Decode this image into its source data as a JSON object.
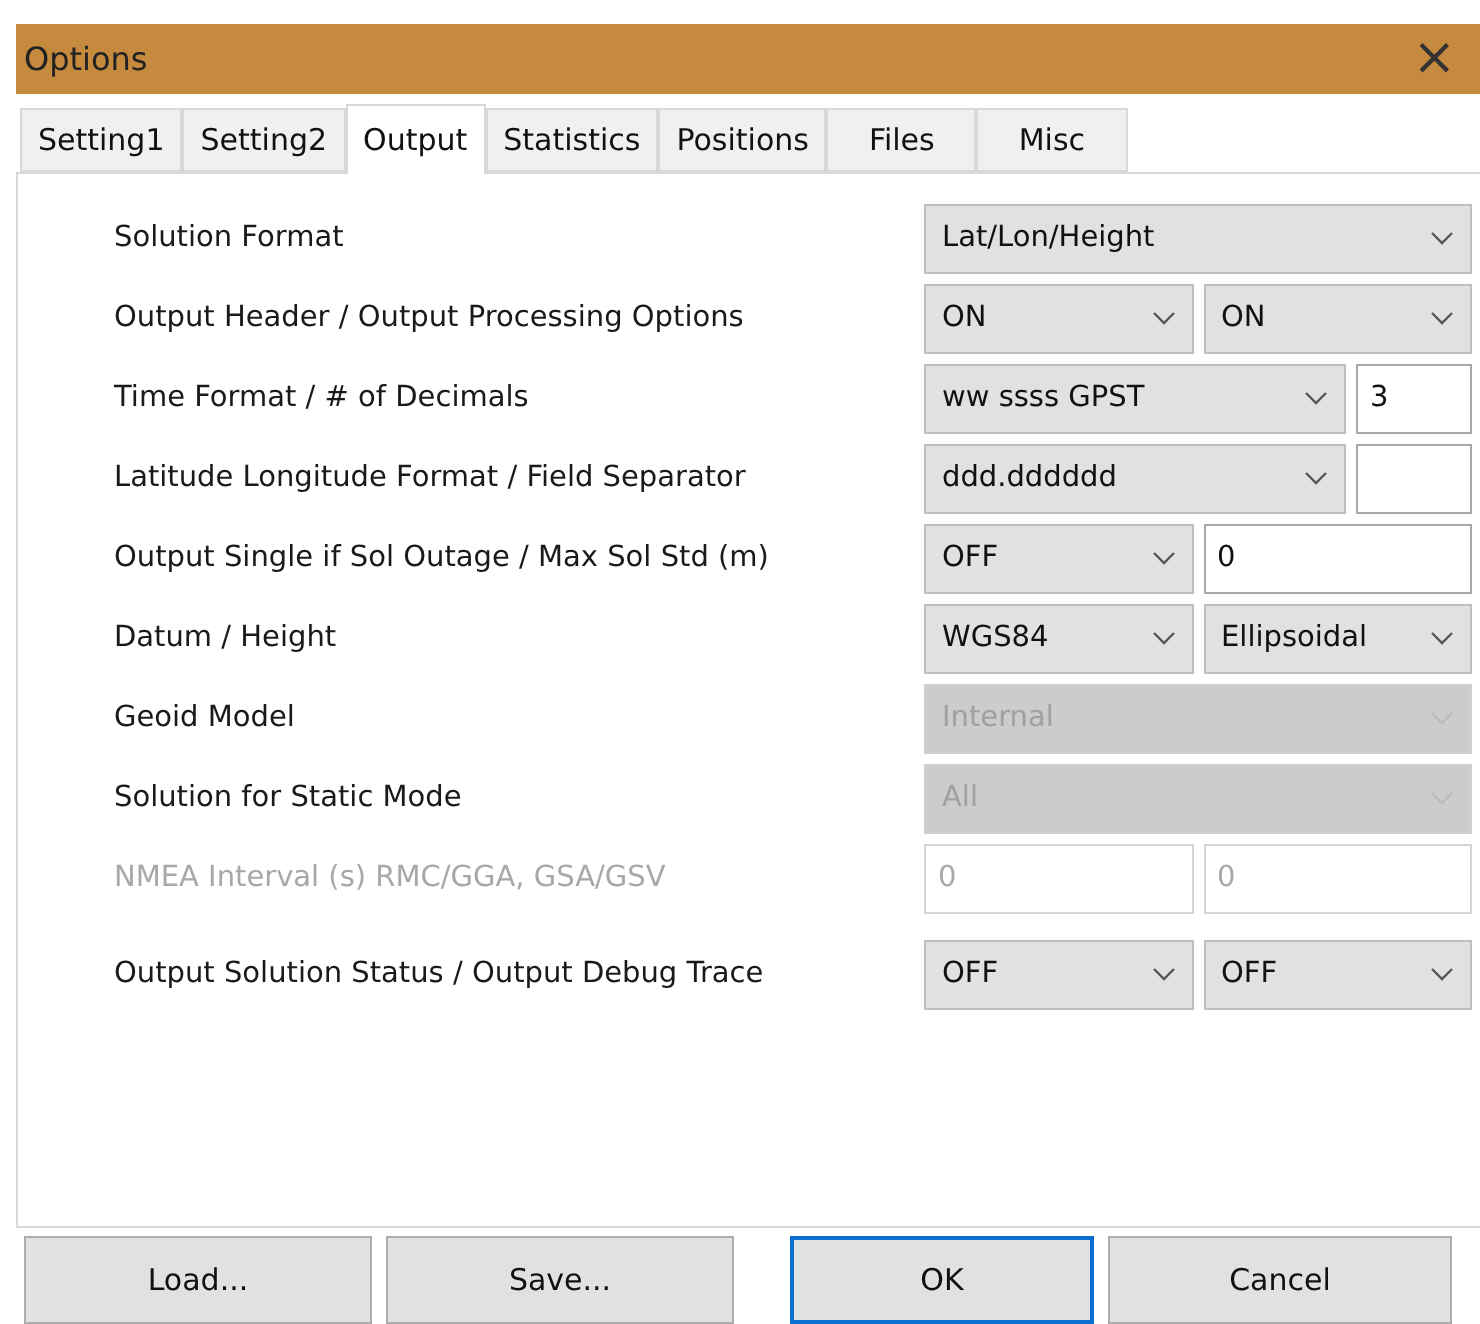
{
  "window": {
    "title": "Options",
    "close": "×"
  },
  "tabs": [
    {
      "label": "Setting1",
      "selected": false
    },
    {
      "label": "Setting2",
      "selected": false
    },
    {
      "label": "Output",
      "selected": true
    },
    {
      "label": "Statistics",
      "selected": false
    },
    {
      "label": "Positions",
      "selected": false
    },
    {
      "label": "Files",
      "selected": false
    },
    {
      "label": "Misc",
      "selected": false
    }
  ],
  "rows": [
    {
      "label": "Solution Format",
      "disabled": false,
      "kind": "full",
      "fields": [
        {
          "kind": "select",
          "value": "Lat/Lon/Height",
          "disabled": false
        }
      ]
    },
    {
      "label": "Output Header / Output Processing Options",
      "disabled": false,
      "kind": "pair",
      "fields": [
        {
          "kind": "select",
          "value": "ON",
          "disabled": false
        },
        {
          "kind": "select",
          "value": "ON",
          "disabled": false
        }
      ]
    },
    {
      "label": "Time Format / # of Decimals",
      "disabled": false,
      "kind": "wide",
      "fields": [
        {
          "kind": "select",
          "value": "ww ssss GPST",
          "disabled": false
        },
        {
          "kind": "input",
          "value": "3",
          "disabled": false
        }
      ]
    },
    {
      "label": "Latitude Longitude Format / Field Separator",
      "disabled": false,
      "kind": "wide",
      "fields": [
        {
          "kind": "select",
          "value": "ddd.dddddd",
          "disabled": false
        },
        {
          "kind": "input",
          "disabled": false
        }
      ]
    },
    {
      "label": "Output Single if Sol Outage / Max Sol Std (m)",
      "disabled": false,
      "kind": "pair",
      "fields": [
        {
          "kind": "select",
          "value": "OFF",
          "disabled": false
        },
        {
          "kind": "input",
          "value": "0",
          "disabled": false
        }
      ]
    },
    {
      "label": "Datum / Height",
      "disabled": false,
      "kind": "pair",
      "fields": [
        {
          "kind": "select",
          "value": "WGS84",
          "disabled": false
        },
        {
          "kind": "select",
          "value": "Ellipsoidal",
          "disabled": false
        }
      ]
    },
    {
      "label": "Geoid Model",
      "disabled": false,
      "kind": "full",
      "fields": [
        {
          "kind": "select",
          "value": "Internal",
          "disabled": true
        }
      ]
    },
    {
      "label": "Solution for Static Mode",
      "disabled": false,
      "kind": "full",
      "fields": [
        {
          "kind": "select",
          "value": "All",
          "disabled": true
        }
      ]
    },
    {
      "label": "NMEA Interval (s) RMC/GGA, GSA/GSV",
      "disabled": true,
      "kind": "pair",
      "fields": [
        {
          "kind": "input",
          "value": "0",
          "disabled": true
        },
        {
          "kind": "input",
          "value": "0",
          "disabled": true
        }
      ]
    },
    {
      "label": "Output Solution Status / Output Debug Trace",
      "disabled": false,
      "kind": "pair",
      "fields": [
        {
          "kind": "select",
          "value": "OFF",
          "disabled": false
        },
        {
          "kind": "select",
          "value": "OFF",
          "disabled": false
        }
      ]
    }
  ],
  "buttons": [
    {
      "label": "Load...",
      "default": false
    },
    {
      "label": "Save...",
      "default": false
    },
    {
      "label": "OK",
      "default": true
    },
    {
      "label": "Cancel",
      "default": false
    }
  ]
}
